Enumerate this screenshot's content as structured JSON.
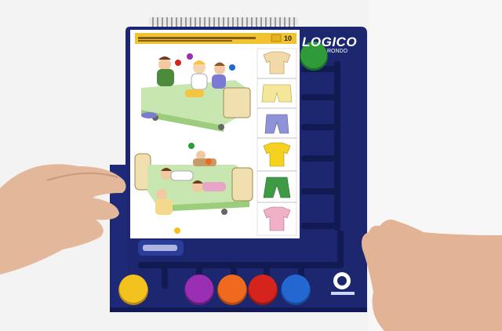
{
  "board": {
    "brand_top": "LOGICO",
    "brand_sub": "RONDO",
    "card_number": "10",
    "colors": {
      "frame": "#1c2770",
      "card_banner": "#f2c230",
      "page": "#ffffff"
    }
  },
  "buttons": [
    {
      "name": "green-marker",
      "color": "#2f9a3a"
    },
    {
      "name": "yellow-button",
      "color": "#f4c21f"
    },
    {
      "name": "purple-button",
      "color": "#9a2fb3"
    },
    {
      "name": "orange-button",
      "color": "#ef6a1e"
    },
    {
      "name": "red-button",
      "color": "#d4241b"
    },
    {
      "name": "blue-button",
      "color": "#2367d1"
    }
  ],
  "clothes": [
    "sweater-icon",
    "shorts-icon",
    "pants-icon",
    "yellow-shirt-icon",
    "green-pants-icon",
    "pink-sweater-icon"
  ]
}
